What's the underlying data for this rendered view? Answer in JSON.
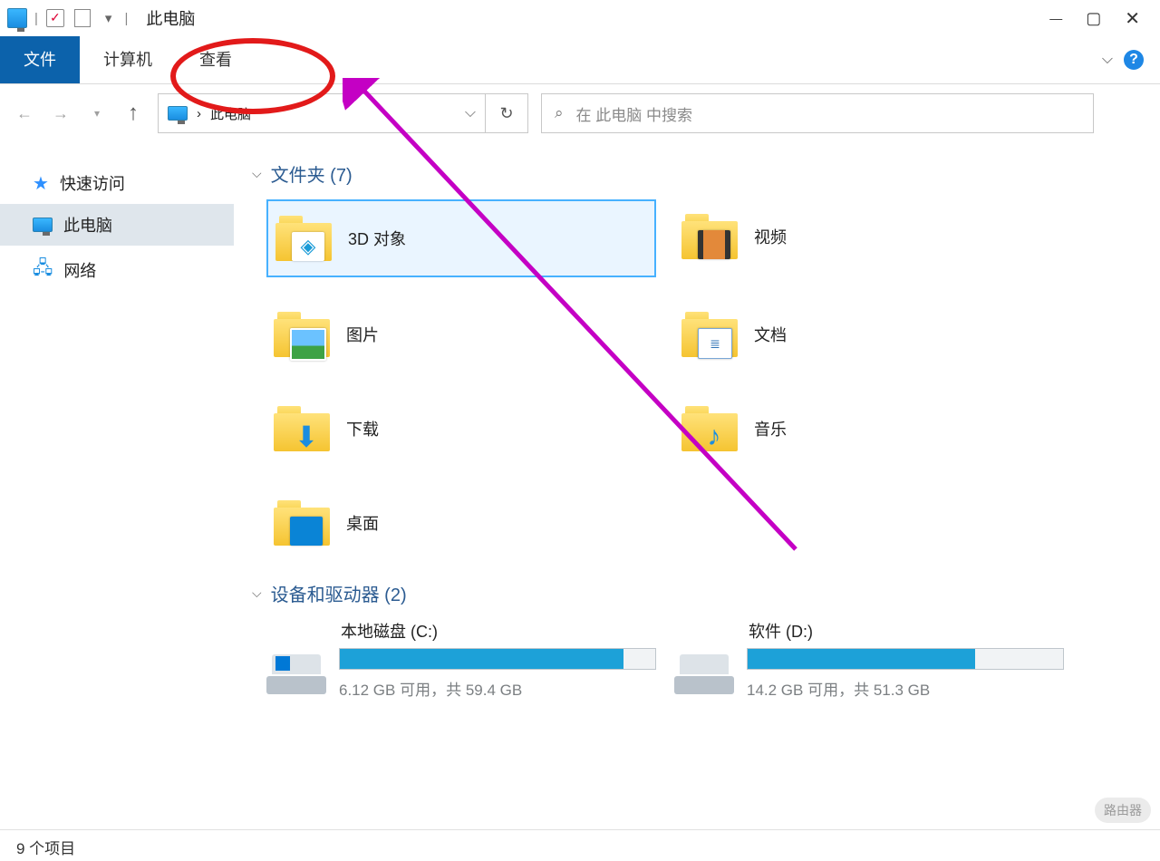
{
  "window": {
    "title": "此电脑"
  },
  "ribbon": {
    "tabs": {
      "file": "文件",
      "computer": "计算机",
      "view": "查看"
    }
  },
  "nav": {
    "location": "此电脑",
    "separator": "›"
  },
  "search": {
    "placeholder": "在 此电脑 中搜索"
  },
  "sidebar": {
    "items": [
      {
        "label": "快速访问"
      },
      {
        "label": "此电脑"
      },
      {
        "label": "网络"
      }
    ]
  },
  "groups": {
    "folders": {
      "header": "文件夹 (7)"
    },
    "devices": {
      "header": "设备和驱动器 (2)"
    }
  },
  "folders": [
    {
      "label": "3D 对象",
      "icon": "cube"
    },
    {
      "label": "视频",
      "icon": "film"
    },
    {
      "label": "图片",
      "icon": "picture"
    },
    {
      "label": "文档",
      "icon": "doc"
    },
    {
      "label": "下载",
      "icon": "download"
    },
    {
      "label": "音乐",
      "icon": "music"
    },
    {
      "label": "桌面",
      "icon": "desktop"
    }
  ],
  "drives": [
    {
      "name": "本地磁盘 (C:)",
      "usage": "6.12 GB 可用，共 59.4 GB",
      "fill": 90,
      "kind": "c"
    },
    {
      "name": "软件 (D:)",
      "usage": "14.2 GB 可用，共 51.3 GB",
      "fill": 72,
      "kind": "d"
    }
  ],
  "status": {
    "items": "9 个项目"
  },
  "watermark": "路由器"
}
